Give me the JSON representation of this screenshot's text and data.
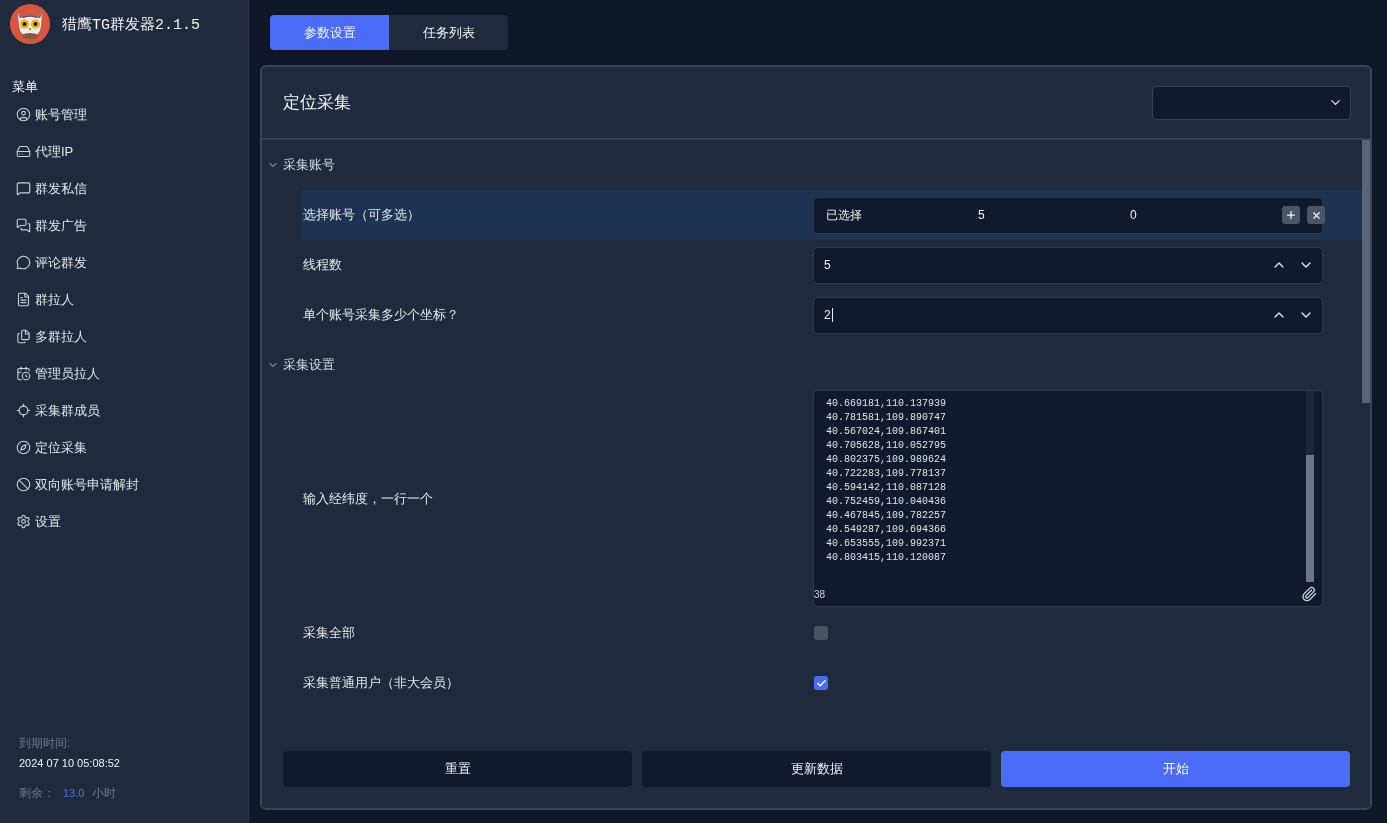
{
  "app": {
    "title": "猎鹰TG群发器2.1.5"
  },
  "sidebar": {
    "heading": "菜单",
    "items": [
      {
        "label": "账号管理",
        "selected": false
      },
      {
        "label": "代理IP",
        "selected": false
      },
      {
        "label": "群发私信",
        "selected": false
      },
      {
        "label": "群发广告",
        "selected": false
      },
      {
        "label": "评论群发",
        "selected": false
      },
      {
        "label": "群拉人",
        "selected": false
      },
      {
        "label": "多群拉人",
        "selected": false
      },
      {
        "label": "管理员拉人",
        "selected": false
      },
      {
        "label": "采集群成员",
        "selected": false
      },
      {
        "label": "定位采集",
        "selected": false
      },
      {
        "label": "双向账号申请解封",
        "selected": false
      },
      {
        "label": "设置",
        "selected": false
      }
    ],
    "expiry": {
      "label": "到期时间:",
      "value": "2024 07 10 05:08:52"
    },
    "remaining": {
      "label": "剩余：",
      "value": "13.0",
      "unit": "小时"
    }
  },
  "tabs": [
    {
      "label": "参数设置",
      "selected": true
    },
    {
      "label": "任务列表",
      "selected": false
    }
  ],
  "panel": {
    "title": "定位采集",
    "sections": [
      {
        "title": "采集账号",
        "expanded": true,
        "rows": [
          {
            "kind": "picker",
            "label": "选择账号（可多选）",
            "highlighted": true,
            "values": [
              "已选择",
              "5",
              "0"
            ]
          },
          {
            "kind": "number",
            "label": "线程数",
            "highlighted": false,
            "value": "5",
            "focused": false
          },
          {
            "kind": "number",
            "label": "单个账号采集多少个坐标？",
            "highlighted": false,
            "value": "2",
            "focused": true
          }
        ]
      },
      {
        "title": "采集设置",
        "expanded": true,
        "rows": [
          {
            "kind": "textarea",
            "label": "输入经纬度，一行一个",
            "highlighted": false,
            "lines": [
              "40.669181,110.137939",
              "40.781581,109.890747",
              "40.567024,109.867401",
              "40.705628,110.052795",
              "40.802375,109.989624",
              "40.722283,109.778137",
              "40.594142,110.087128",
              "40.752459,110.040436",
              "40.467845,109.782257",
              "40.549287,109.694366",
              "40.653555,109.992371",
              "40.803415,110.120087"
            ],
            "count": "38"
          },
          {
            "kind": "checkbox",
            "label": "采集全部",
            "highlighted": false,
            "checked": false
          },
          {
            "kind": "checkbox",
            "label": "采集普通用户（非大会员）",
            "highlighted": false,
            "checked": true
          }
        ]
      }
    ]
  },
  "buttons": [
    {
      "label": "重置",
      "kind": "secondary"
    },
    {
      "label": "更新数据",
      "kind": "secondary"
    },
    {
      "label": "开始",
      "kind": "primary"
    }
  ]
}
